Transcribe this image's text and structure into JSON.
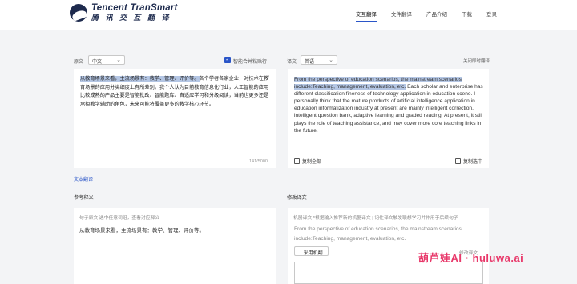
{
  "brand": {
    "name_en": "Tencent TranSmart",
    "name_cn": "腾 讯 交 互 翻 译"
  },
  "nav": {
    "items": [
      "交互翻译",
      "文件翻译",
      "产品介绍",
      "下载",
      "登录"
    ]
  },
  "source": {
    "label": "原文",
    "lang": "中文",
    "merge_label": "智能合并粘贴行",
    "text_highlight": "从教育场景来看，主流场景有：教学、管理、评价等。",
    "text_rest": "各个学者各家企业，对技术在教育场景的应用分类细度上有所差别。我个人认为目前教育信息化行业，人工智能的应用比较成熟的产品主要是智能批改、智能题库、自适应学习和分级阅读，当前也更多还是承担教学辅助的角色，未来可能将覆盖更多的教学核心环节。",
    "counter": "141/5000"
  },
  "target": {
    "label": "译文",
    "lang": "英语",
    "close_toggle": "关闭即时翻译",
    "text_highlight": "From the perspective of education scenarios, the mainstream scenarios include:Teaching, management, evaluation, etc.",
    "text_rest": " Each scholar and enterprise has different classification fineness of technology application in education scene. I personally think that the mature products of artificial intelligence application in education informatization industry at present are mainly intelligent correction, intelligent question bank, adaptive learning and graded reading. At present, it still plays the role of teaching assistance, and may cover more core teaching links in the future.",
    "copy_all": "复制全部",
    "copy_selected": "复制选中"
  },
  "doc_translate_link": "文本翻译",
  "reference": {
    "title": "参考释义",
    "hint": "句子原文  选中任意词组，查看对应释义",
    "sentence": "从教育场景来看，主流场景有：教学、管理、评价等。"
  },
  "edit": {
    "title": "修改译文",
    "hint": "机器译文  *根据输入推荐新的机器译文 | 记住译文触发联想学习并作用于后续句子",
    "machine_text": "From the perspective of education scenarios, the mainstream scenarios include:Teaching, management, evaluation, etc.",
    "edited_label": "修改译文",
    "use_button": "↓ 采用机翻"
  },
  "watermark": "葫芦娃AI · huluwa.ai"
}
